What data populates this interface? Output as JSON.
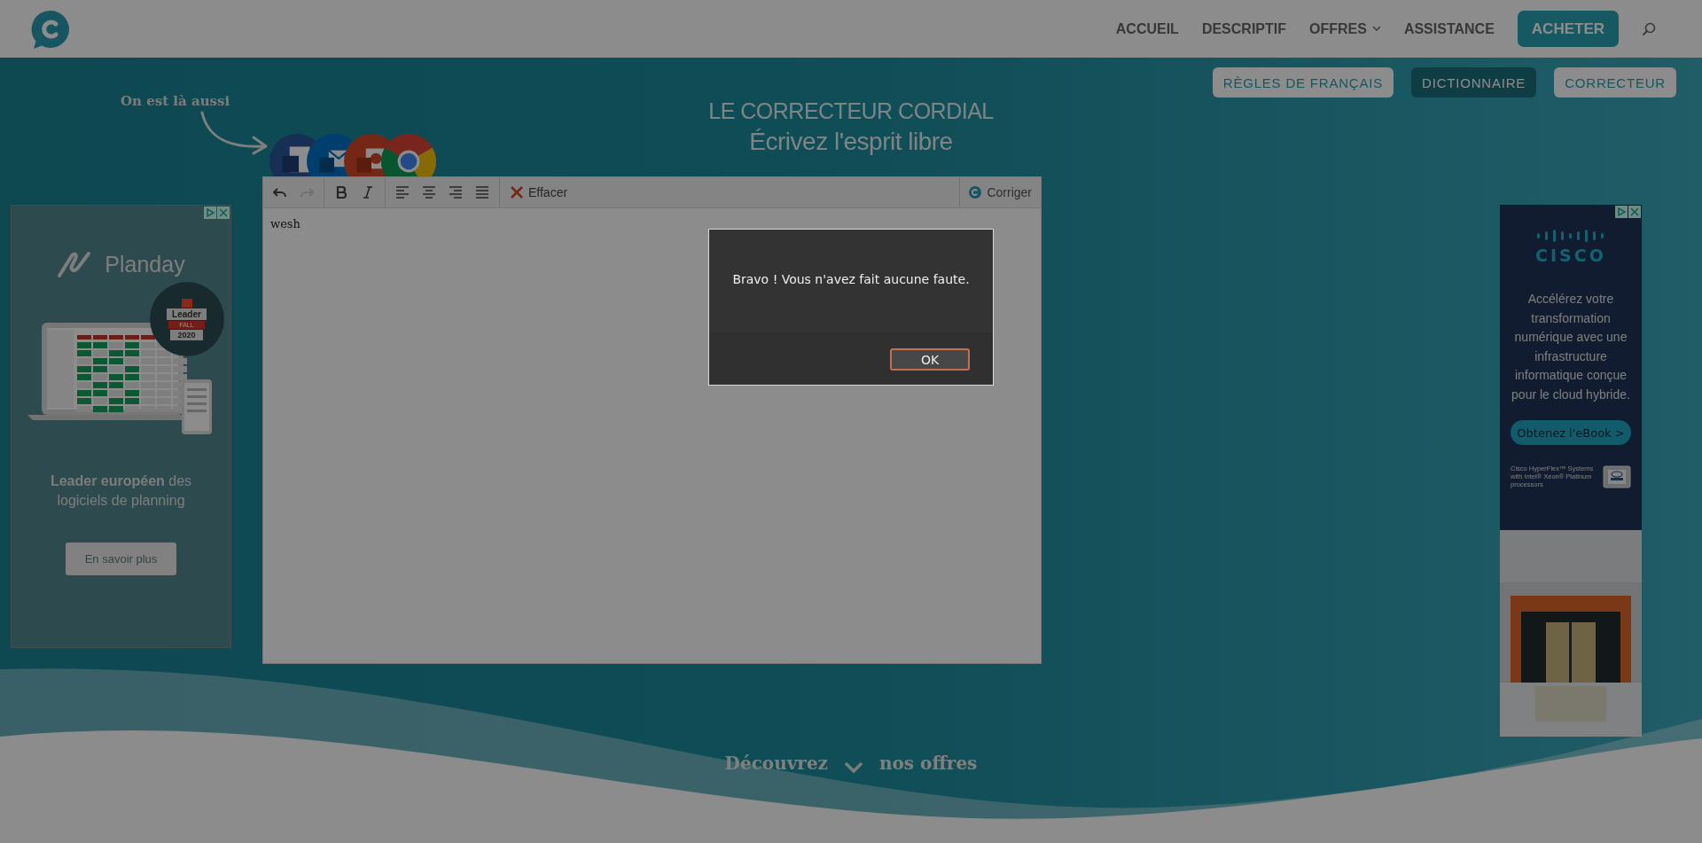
{
  "header": {
    "nav": [
      {
        "label": "ACCUEIL",
        "kind": "link"
      },
      {
        "label": "DESCRIPTIF",
        "kind": "link"
      },
      {
        "label": "OFFRES",
        "kind": "dropdown"
      },
      {
        "label": "ASSISTANCE",
        "kind": "link"
      }
    ],
    "cta": "ACHETER"
  },
  "subnav": [
    {
      "label": "RÈGLES DE FRANÇAIS",
      "selected": false
    },
    {
      "label": "DICTIONNAIRE",
      "selected": true
    },
    {
      "label": "CORRECTEUR",
      "selected": false
    }
  ],
  "promo": {
    "text": "On est là aussi"
  },
  "heading": {
    "title": "LE CORRECTEUR CORDIAL",
    "subtitle": "Écrivez l'esprit libre"
  },
  "editor": {
    "toolbar": [
      {
        "buttons": [
          {
            "kind": "undo",
            "disabled": false
          },
          {
            "kind": "redo",
            "disabled": true
          }
        ]
      },
      {
        "buttons": [
          {
            "kind": "bold",
            "disabled": false
          },
          {
            "kind": "italic",
            "disabled": false
          }
        ]
      },
      {
        "buttons": [
          {
            "kind": "align-left",
            "disabled": false
          },
          {
            "kind": "align-center",
            "disabled": false
          },
          {
            "kind": "align-right",
            "disabled": false
          },
          {
            "kind": "justify",
            "disabled": false
          }
        ]
      },
      {
        "buttons": [
          {
            "kind": "clear",
            "label": "Effacer",
            "disabled": false
          }
        ]
      }
    ],
    "correct_button": "Corriger",
    "text": "wesh"
  },
  "left_ad": {
    "brand": "Planday",
    "badge": {
      "title": "Leader",
      "season": "FALL",
      "year": "2020"
    },
    "tagline": "**Leader européen** des logiciels de planning",
    "button": "En savoir plus"
  },
  "right_ad": {
    "brand": "CISCO",
    "text": "Accélérez votre transformation numérique avec une infrastructure informatique conçue pour le cloud hybride.",
    "button": "Obtenez l'eBook >",
    "note": "Cisco HyperFlex™ Systems with Intel® Xeon® Platinum processors"
  },
  "footer_cta": {
    "before": "Découvrez",
    "after": "nos offres"
  },
  "dialog": {
    "message": "Bravo ! Vous n'avez fait aucune faute.",
    "button": "OK"
  }
}
